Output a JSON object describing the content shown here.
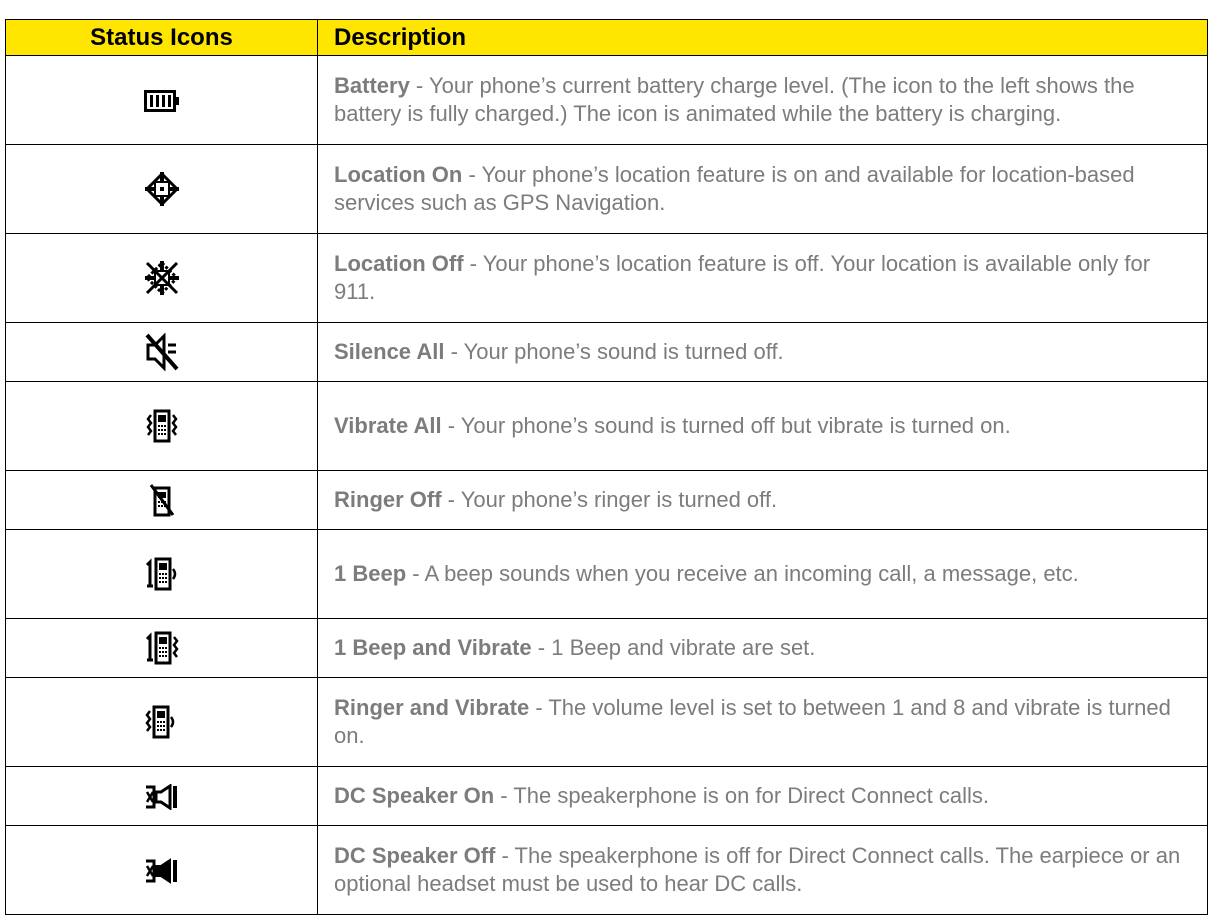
{
  "header": {
    "icons": "Status Icons",
    "description": "Description"
  },
  "rows": [
    {
      "icon": "battery-full-icon",
      "term": "Battery",
      "sep": " - ",
      "text": "Your phone’s current battery charge level. (The icon to the left shows the battery is fully charged.) The icon is animated while the battery is charging."
    },
    {
      "icon": "location-on-icon",
      "term": "Location On",
      "sep": " - ",
      "text": "Your phone’s location feature is on and available for location-based services such as GPS Navigation."
    },
    {
      "icon": "location-off-icon",
      "term": "Location Off",
      "sep": " - ",
      "text": "Your phone’s location feature is off. Your location is available only for 911."
    },
    {
      "icon": "silence-all-icon",
      "term": "Silence All",
      "sep": " - ",
      "text": "Your phone’s sound is turned off."
    },
    {
      "icon": "vibrate-all-icon",
      "term": "Vibrate All",
      "sep": " - ",
      "text": "Your phone’s sound is turned off but vibrate is turned on."
    },
    {
      "icon": "ringer-off-icon",
      "term": "Ringer Off",
      "sep": " - ",
      "text": "Your phone’s ringer is turned off."
    },
    {
      "icon": "one-beep-icon",
      "term": "1 Beep",
      "sep": " - ",
      "text": "A beep sounds when you receive an incoming call, a message, etc."
    },
    {
      "icon": "one-beep-vibrate-icon",
      "term": "1 Beep and Vibrate",
      "sep": " - ",
      "text": "1 Beep and vibrate are set."
    },
    {
      "icon": "ringer-vibrate-icon",
      "term": "Ringer and Vibrate",
      "sep": " - ",
      "text": "The volume level is set to between 1 and 8 and vibrate is turned on."
    },
    {
      "icon": "dc-speaker-on-icon",
      "term": "DC Speaker On",
      "sep": " - ",
      "text": "The speakerphone is on for Direct Connect calls."
    },
    {
      "icon": "dc-speaker-off-icon",
      "term": "DC Speaker Off",
      "sep": " - ",
      "text": "The speakerphone is off for Direct Connect calls. The earpiece or an optional headset must be used to hear DC calls."
    }
  ]
}
